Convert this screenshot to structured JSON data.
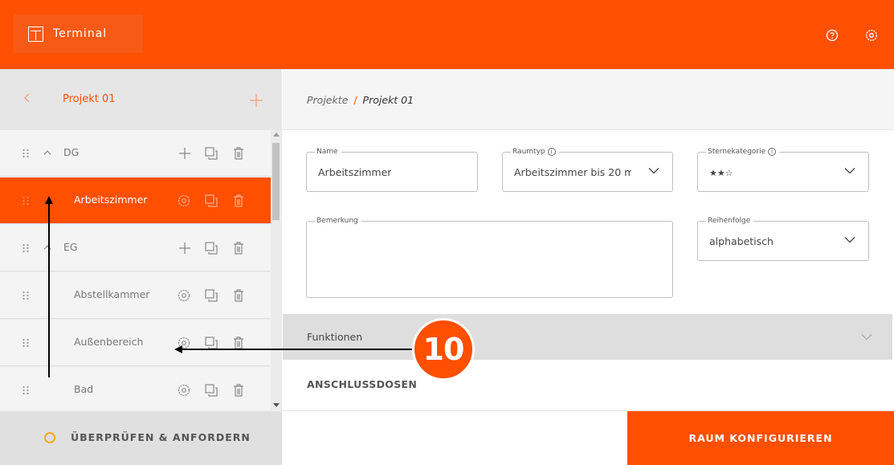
{
  "header": {
    "app_name": "Terminal",
    "icons": [
      "help-icon",
      "settings-icon"
    ],
    "color": "#ff4f00"
  },
  "sidebar": {
    "project": "Projekt 01",
    "rows": [
      {
        "label": "DG",
        "type": "group"
      },
      {
        "label": "Arbeitszimmer",
        "type": "room",
        "active": true
      },
      {
        "label": "EG",
        "type": "group"
      },
      {
        "label": "Abstellkammer",
        "type": "room"
      },
      {
        "label": "Außenbereich",
        "type": "room"
      },
      {
        "label": "Bad",
        "type": "room"
      }
    ],
    "review_label": "ÜBERPRÜFEN & ANFORDERN"
  },
  "main": {
    "breadcrumb": {
      "root": "Projekte",
      "separator": "/",
      "current": "Projekt 01"
    },
    "form": {
      "name": {
        "label": "Name",
        "value": "Arbeitszimmer"
      },
      "raumtyp": {
        "label": "Raumtyp",
        "value": "Arbeitszimmer bis 20 m"
      },
      "sternekategorie": {
        "label": "Sternekategorie",
        "value": "★★☆"
      },
      "bemerkung": {
        "label": "Bemerkung",
        "value": ""
      },
      "reihenfolge": {
        "label": "Reihenfolge",
        "value": "alphabetisch"
      }
    },
    "funktionen": "Funktionen",
    "anschlussdosen": "ANSCHLUSSDOSEN",
    "configure_label": "RAUM KONFIGURIEREN"
  },
  "annotation": {
    "badge": "10"
  }
}
